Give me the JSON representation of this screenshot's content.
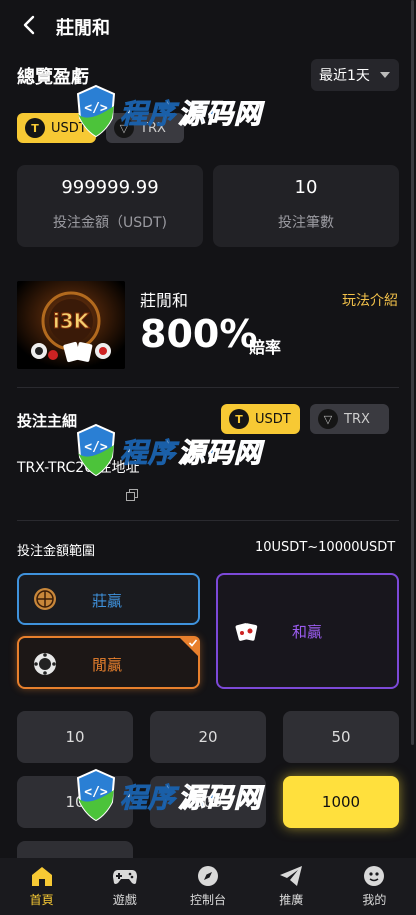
{
  "header": {
    "title": "莊閒和"
  },
  "overview": {
    "title": "總覽盈虧",
    "period": "最近1天"
  },
  "currency_tabs_top": [
    {
      "label": "USDT",
      "icon": "tether-icon"
    },
    {
      "label": "TRX",
      "icon": "tron-icon"
    }
  ],
  "stats": [
    {
      "value": "999999.99",
      "label": "投注金額（USDT)"
    },
    {
      "value": "10",
      "label": "投注筆數"
    }
  ],
  "game": {
    "logo_text": "i3K",
    "name": "莊閒和",
    "rules_link": "玩法介紹",
    "odds": "800%",
    "odds_label": "賠率"
  },
  "bet_address": {
    "title": "投注主細",
    "chip_usdt": "USDT",
    "chip_trx": "TRX",
    "text": "TRX-TRC20 注地址"
  },
  "bet_range": {
    "label": "投注金額範圍",
    "value": "10USDT~10000USDT"
  },
  "bets": [
    {
      "label": "莊贏",
      "selected": false,
      "color": "#3f92dc"
    },
    {
      "label": "閒贏",
      "selected": true,
      "color": "#e8802d"
    },
    {
      "label": "和贏",
      "selected": false,
      "color": "#7c49d8"
    }
  ],
  "amounts": [
    "10",
    "20",
    "50",
    "10",
    "500",
    "1000"
  ],
  "selected_amount": "1000",
  "watermark": {
    "part1": "程序",
    "part2": "源码网"
  },
  "nav": [
    {
      "label": "首頁",
      "icon": "home-icon",
      "active": true
    },
    {
      "label": "遊戲",
      "icon": "gamepad-icon",
      "active": false
    },
    {
      "label": "控制台",
      "icon": "compass-icon",
      "active": false
    },
    {
      "label": "推廣",
      "icon": "send-icon",
      "active": false
    },
    {
      "label": "我的",
      "icon": "profile-icon",
      "active": false
    }
  ],
  "colors": {
    "accent": "#f7c934",
    "background": "#131316",
    "card": "#222226"
  }
}
